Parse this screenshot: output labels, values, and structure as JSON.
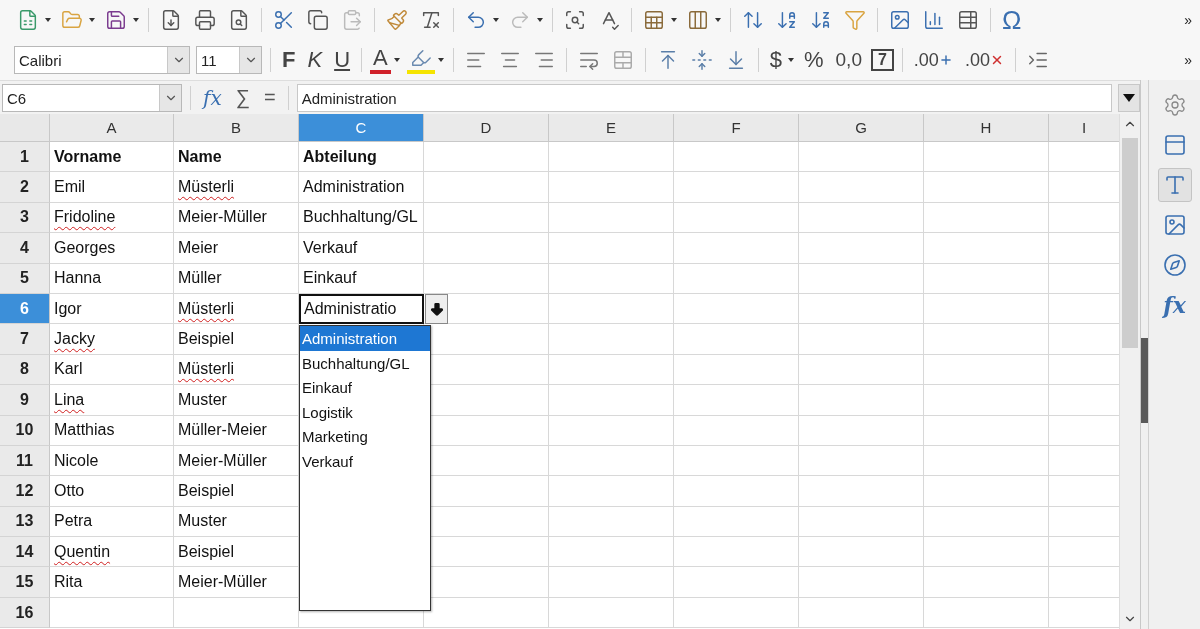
{
  "standard_toolbar": {
    "special_character": "Ω",
    "overflow": "»"
  },
  "formatting_toolbar": {
    "font_name": "Calibri",
    "font_size": "11",
    "bold": "F",
    "italic": "K",
    "underline": "U",
    "font_color": "A",
    "currency": "$",
    "percent": "%",
    "number_format": "0,0",
    "date_format": "7",
    "add_decimal": ".00",
    "delete_decimal": ".00",
    "overflow": "»"
  },
  "formula_bar": {
    "name_box": "C6",
    "function_wizard": "fx",
    "sum": "∑",
    "equals": "=",
    "content": "Administration"
  },
  "sheet": {
    "columns": [
      {
        "label": "A",
        "selected": false
      },
      {
        "label": "B",
        "selected": false
      },
      {
        "label": "C",
        "selected": true
      },
      {
        "label": "D",
        "selected": false
      },
      {
        "label": "E",
        "selected": false
      },
      {
        "label": "F",
        "selected": false
      },
      {
        "label": "G",
        "selected": false
      },
      {
        "label": "H",
        "selected": false
      },
      {
        "label": "I",
        "selected": false
      }
    ],
    "rows": [
      {
        "number": "1",
        "selected": false,
        "cells": [
          {
            "text": "Vorname",
            "bold": true,
            "misspelled": false,
            "active": false
          },
          {
            "text": "Name",
            "bold": true,
            "misspelled": false,
            "active": false
          },
          {
            "text": "Abteilung",
            "bold": true,
            "misspelled": false,
            "active": false
          }
        ]
      },
      {
        "number": "2",
        "selected": false,
        "cells": [
          {
            "text": "Emil",
            "bold": false,
            "misspelled": false,
            "active": false
          },
          {
            "text": "Müsterli",
            "bold": false,
            "misspelled": true,
            "active": false
          },
          {
            "text": "Administration",
            "bold": false,
            "misspelled": false,
            "active": false
          }
        ]
      },
      {
        "number": "3",
        "selected": false,
        "cells": [
          {
            "text": "Fridoline",
            "bold": false,
            "misspelled": true,
            "active": false
          },
          {
            "text": "Meier-Müller",
            "bold": false,
            "misspelled": false,
            "active": false
          },
          {
            "text": "Buchhaltung/GL",
            "bold": false,
            "misspelled": false,
            "active": false
          }
        ]
      },
      {
        "number": "4",
        "selected": false,
        "cells": [
          {
            "text": "Georges",
            "bold": false,
            "misspelled": false,
            "active": false
          },
          {
            "text": "Meier",
            "bold": false,
            "misspelled": false,
            "active": false
          },
          {
            "text": "Verkauf",
            "bold": false,
            "misspelled": false,
            "active": false
          }
        ]
      },
      {
        "number": "5",
        "selected": false,
        "cells": [
          {
            "text": "Hanna",
            "bold": false,
            "misspelled": false,
            "active": false
          },
          {
            "text": "Müller",
            "bold": false,
            "misspelled": false,
            "active": false
          },
          {
            "text": "Einkauf",
            "bold": false,
            "misspelled": false,
            "active": false
          }
        ]
      },
      {
        "number": "6",
        "selected": true,
        "cells": [
          {
            "text": "Igor",
            "bold": false,
            "misspelled": false,
            "active": false
          },
          {
            "text": "Müsterli",
            "bold": false,
            "misspelled": true,
            "active": false
          },
          {
            "text": "Administratio",
            "bold": false,
            "misspelled": false,
            "active": true
          }
        ]
      },
      {
        "number": "7",
        "selected": false,
        "cells": [
          {
            "text": "Jacky",
            "bold": false,
            "misspelled": true,
            "active": false
          },
          {
            "text": "Beispiel",
            "bold": false,
            "misspelled": false,
            "active": false
          }
        ]
      },
      {
        "number": "8",
        "selected": false,
        "cells": [
          {
            "text": "Karl",
            "bold": false,
            "misspelled": false,
            "active": false
          },
          {
            "text": "Müsterli",
            "bold": false,
            "misspelled": true,
            "active": false
          }
        ]
      },
      {
        "number": "9",
        "selected": false,
        "cells": [
          {
            "text": "Lina",
            "bold": false,
            "misspelled": true,
            "active": false
          },
          {
            "text": "Muster",
            "bold": false,
            "misspelled": false,
            "active": false
          }
        ]
      },
      {
        "number": "10",
        "selected": false,
        "cells": [
          {
            "text": "Matthias",
            "bold": false,
            "misspelled": false,
            "active": false
          },
          {
            "text": "Müller-Meier",
            "bold": false,
            "misspelled": false,
            "active": false
          }
        ]
      },
      {
        "number": "11",
        "selected": false,
        "cells": [
          {
            "text": "Nicole",
            "bold": false,
            "misspelled": false,
            "active": false
          },
          {
            "text": "Meier-Müller",
            "bold": false,
            "misspelled": false,
            "active": false
          }
        ]
      },
      {
        "number": "12",
        "selected": false,
        "cells": [
          {
            "text": "Otto",
            "bold": false,
            "misspelled": false,
            "active": false
          },
          {
            "text": "Beispiel",
            "bold": false,
            "misspelled": false,
            "active": false
          }
        ]
      },
      {
        "number": "13",
        "selected": false,
        "cells": [
          {
            "text": "Petra",
            "bold": false,
            "misspelled": false,
            "active": false
          },
          {
            "text": "Muster",
            "bold": false,
            "misspelled": false,
            "active": false
          }
        ]
      },
      {
        "number": "14",
        "selected": false,
        "cells": [
          {
            "text": "Quentin",
            "bold": false,
            "misspelled": true,
            "active": false
          },
          {
            "text": "Beispiel",
            "bold": false,
            "misspelled": false,
            "active": false
          }
        ]
      },
      {
        "number": "15",
        "selected": false,
        "cells": [
          {
            "text": "Rita",
            "bold": false,
            "misspelled": false,
            "active": false
          },
          {
            "text": "Meier-Müller",
            "bold": false,
            "misspelled": false,
            "active": false
          }
        ]
      },
      {
        "number": "16",
        "selected": false
      }
    ],
    "validation_list": {
      "items": [
        {
          "label": "Administration",
          "selected": true
        },
        {
          "label": "Buchhaltung/GL",
          "selected": false
        },
        {
          "label": "Einkauf",
          "selected": false
        },
        {
          "label": "Logistik",
          "selected": false
        },
        {
          "label": "Marketing",
          "selected": false
        },
        {
          "label": "Verkauf",
          "selected": false
        }
      ]
    }
  },
  "sidebar": {
    "tabs": [
      {
        "kind": "properties",
        "selected": false
      },
      {
        "kind": "styles",
        "selected": true
      },
      {
        "kind": "gallery",
        "selected": false
      },
      {
        "kind": "navigator",
        "selected": false
      },
      {
        "kind": "functions",
        "selected": false,
        "glyph": "fx"
      }
    ]
  }
}
